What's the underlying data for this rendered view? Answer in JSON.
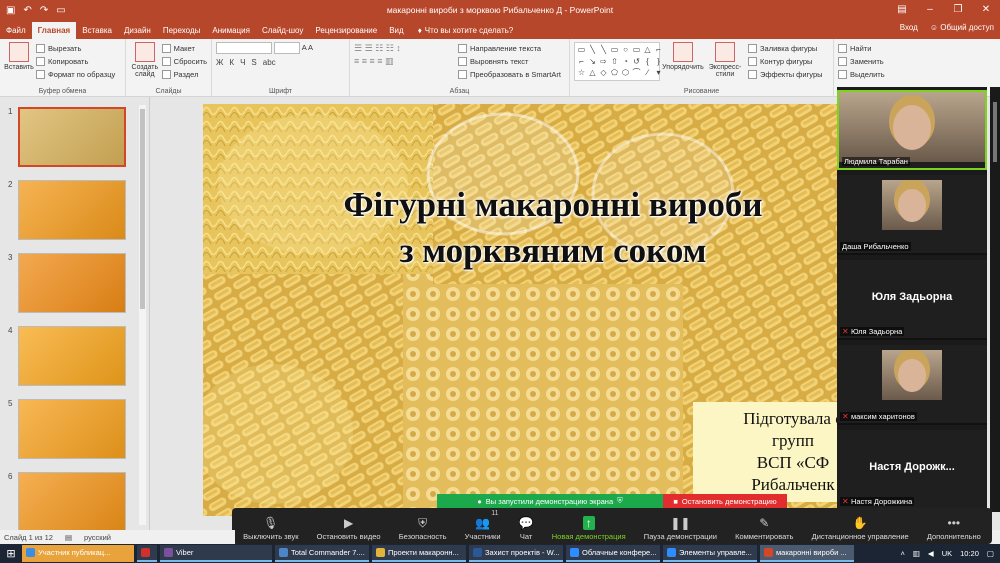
{
  "window": {
    "title": "макаронні вироби з морквою Рибальченко Д - PowerPoint",
    "qat_icons": [
      "save-icon",
      "undo-icon",
      "redo-icon",
      "present-icon"
    ]
  },
  "tabs": [
    "Файл",
    "Главная",
    "Вставка",
    "Дизайн",
    "Переходы",
    "Анимация",
    "Слайд-шоу",
    "Рецензирование",
    "Вид"
  ],
  "active_tab": "Главная",
  "tell_me": "Что вы хотите сделать?",
  "signin": "Вход",
  "share": "Общий доступ",
  "ribbon": {
    "clipboard": {
      "paste": "Вставить",
      "cut": "Вырезать",
      "copy": "Копировать",
      "format_painter": "Формат по образцу",
      "name": "Буфер обмена"
    },
    "slides": {
      "new_slide": "Создать слайд",
      "layout": "Макет",
      "reset": "Сбросить",
      "section": "Раздел",
      "name": "Слайды"
    },
    "font": {
      "name": "Шрифт",
      "buttons": [
        "Ж",
        "К",
        "Ч",
        "S",
        "abc"
      ]
    },
    "paragraph": {
      "text_direction": "Направление текста",
      "align_text": "Выровнять текст",
      "smartart": "Преобразовать в SmartArt",
      "name": "Абзац"
    },
    "drawing": {
      "arrange": "Упорядочить",
      "quick_styles": "Экспресс-стили",
      "fill": "Заливка фигуры",
      "outline": "Контур фигуры",
      "effects": "Эффекты фигуры",
      "name": "Рисование"
    },
    "editing": {
      "find": "Найти",
      "replace": "Заменить",
      "select": "Выделить"
    }
  },
  "thumbnails": [
    {
      "num": "1",
      "color": "#d8b25a"
    },
    {
      "num": "2",
      "color": "#f39a1a"
    },
    {
      "num": "3",
      "color": "#f08c16"
    },
    {
      "num": "4",
      "color": "#f7a51c"
    },
    {
      "num": "5",
      "color": "#f6a01c"
    },
    {
      "num": "6",
      "color": "#f29418"
    }
  ],
  "slide": {
    "title": "Фігурні макаронні вироби з морквяним соком",
    "subtitle_lines": [
      "Підготувала с",
      "групп",
      "ВСП «СФ",
      "Рибальченк"
    ]
  },
  "participants": [
    {
      "name": "Людмила Тарабан",
      "video": true
    },
    {
      "name": "Даша Рибальченко",
      "video": true
    },
    {
      "name": "Юля Задьорна",
      "label": "Юля Задьорна",
      "video": false
    },
    {
      "name": "максим харитонов",
      "video": true
    },
    {
      "name": "Настя Дорожкина",
      "label": "Настя Дорожк...",
      "video": false
    }
  ],
  "sharebar": {
    "message": "Вы запустили демонстрацию экрана",
    "stop": "Остановить демонстрацию"
  },
  "zoom_toolbar": [
    {
      "label": "Выключить звук",
      "icon": "🎙"
    },
    {
      "label": "Остановить видео",
      "icon": "▶"
    },
    {
      "label": "Безопасность",
      "icon": "⛨"
    },
    {
      "label": "Участники",
      "icon": "👥",
      "badge": "11"
    },
    {
      "label": "Чат",
      "icon": "💬"
    },
    {
      "label": "Новая демонстрация",
      "icon": "↑"
    },
    {
      "label": "Пауза демонстрации",
      "icon": "❚❚"
    },
    {
      "label": "Комментировать",
      "icon": "✎"
    },
    {
      "label": "Дистанционное управление",
      "icon": "✋"
    },
    {
      "label": "Дополнительно",
      "icon": "•••"
    }
  ],
  "status": {
    "slide": "Слайд 1 из 12",
    "language": "русский"
  },
  "taskbar": [
    {
      "label": "Участник публикац...",
      "color": "#3c8ee3"
    },
    {
      "label": "",
      "color": "#d0312d"
    },
    {
      "label": "Viber",
      "color": "#7b519d"
    },
    {
      "label": "Total Commander 7....",
      "color": "#4b86c8"
    },
    {
      "label": "Проекти макаронн...",
      "color": "#e2b33a"
    },
    {
      "label": "Захист проектів - W...",
      "color": "#2b5797"
    },
    {
      "label": "Облачные конфере...",
      "color": "#2d8cff"
    },
    {
      "label": "Элементы управле...",
      "color": "#2d8cff"
    },
    {
      "label": "макаронні вироби ...",
      "color": "#d24726"
    }
  ],
  "tray": {
    "lang": "UK",
    "time": "10:20"
  }
}
